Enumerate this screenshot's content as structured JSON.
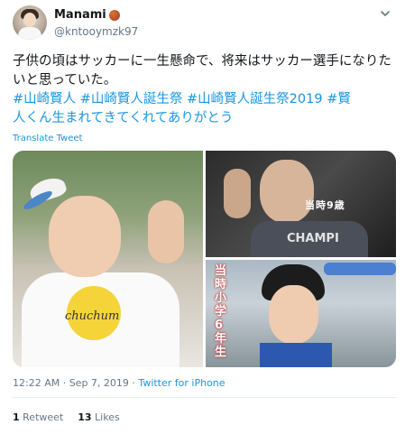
{
  "user": {
    "display_name": "Manami",
    "handle": "@kntooymzk97"
  },
  "tweet": {
    "text_line1": "子供の頃はサッカーに一生懸命で、将来はサッカー選手になりた",
    "text_line2": "いと思っていた。",
    "hashtag1": "#山崎賢人",
    "hashtag2": "#山崎賢人誕生祭",
    "hashtag3": "#山崎賢人誕生祭2019",
    "hashtag4a": "#賢",
    "hashtag4b": "人くん生まれてきてくれてありがとう",
    "translate_label": "Translate Tweet"
  },
  "media": {
    "photo1_shirt_text": "chuchum",
    "photo2_shirt_text": "CHAMPI",
    "photo2_caption": "当時9歳",
    "photo3_caption": "当時小学6年生"
  },
  "meta": {
    "timestamp": "12:22 AM · Sep 7, 2019 · ",
    "source": "Twitter for iPhone"
  },
  "stats": {
    "retweets_count": "1",
    "retweets_label": "Retweet",
    "likes_count": "13",
    "likes_label": "Likes"
  }
}
